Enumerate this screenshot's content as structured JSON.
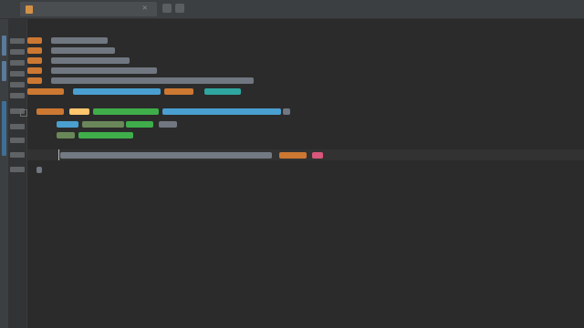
{
  "editor": {
    "tab": {
      "label": " "
    },
    "tab_close_glyph": "✕"
  },
  "colors": {
    "background": "#2b2b2b",
    "tabbar": "#3c3f41",
    "gutter": "#313335",
    "keyword": "#cc7832",
    "string": "#6a8759",
    "function": "#ffc66d",
    "identifier": "#a9b7c6",
    "type": "#4a9fd1",
    "highlight": "#3fae4a",
    "error": "#d9577a"
  },
  "icons": {
    "tab_file": "file-icon",
    "tab_close": "close-icon",
    "fold": "fold-icon"
  }
}
